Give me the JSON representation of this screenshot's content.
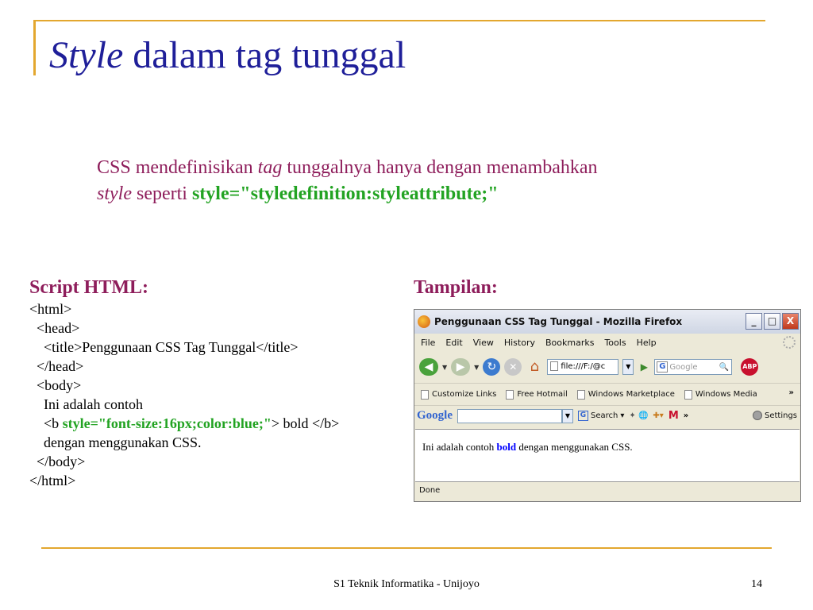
{
  "slide": {
    "title_italic": "Style",
    "title_rest": " dalam tag tunggal",
    "intro": {
      "line1_a": "CSS mendefinisikan ",
      "line1_tag": "tag",
      "line1_b": " tunggalnya hanya dengan menambahkan",
      "line2_style": "style",
      "line2_a": " seperti ",
      "line2_code": "style=\"styledefinition:styleattribute;\""
    },
    "script_heading": "Script HTML:",
    "display_heading": "Tampilan:",
    "code": {
      "l1": "<html>",
      "l2": "  <head>",
      "l3": "    <title>Penggunaan CSS Tag Tunggal</title>",
      "l4": "  </head>",
      "l5": "  <body>",
      "l6": "    Ini adalah contoh",
      "l7_a": "    <b ",
      "l7_green": "style=\"font-size:16px;color:blue;\"",
      "l7_b": "> bold </b>",
      "l8": "    dengan menggunakan CSS.",
      "l9": "  </body>",
      "l10": "</html>"
    },
    "footer": "S1 Teknik Informatika - Unijoyo",
    "page_number": "14"
  },
  "browser": {
    "window_title": "Penggunaan CSS Tag Tunggal - Mozilla Firefox",
    "window_buttons": {
      "minimize": "_",
      "maximize": "□",
      "close": "X"
    },
    "menu": [
      "File",
      "Edit",
      "View",
      "History",
      "Bookmarks",
      "Tools",
      "Help"
    ],
    "url": "file:///F:/@c",
    "search_placeholder": "Google",
    "abp": "ABP",
    "bookmarks": [
      "Customize Links",
      "Free Hotmail",
      "Windows Marketplace",
      "Windows Media"
    ],
    "bookmarks_more": "»",
    "google_brand": "Google",
    "google_search_label": "Search",
    "google_more": "»",
    "google_settings": "Settings",
    "content": {
      "before": "Ini adalah contoh ",
      "bold": "bold",
      "after": " dengan menggunakan CSS."
    },
    "status": "Done"
  },
  "colors": {
    "title": "#1f1f99",
    "body_text": "#8e1d5b",
    "code_highlight": "#22a322",
    "accent_rule": "#e3a72f",
    "bold_blue": "#0000ff"
  }
}
